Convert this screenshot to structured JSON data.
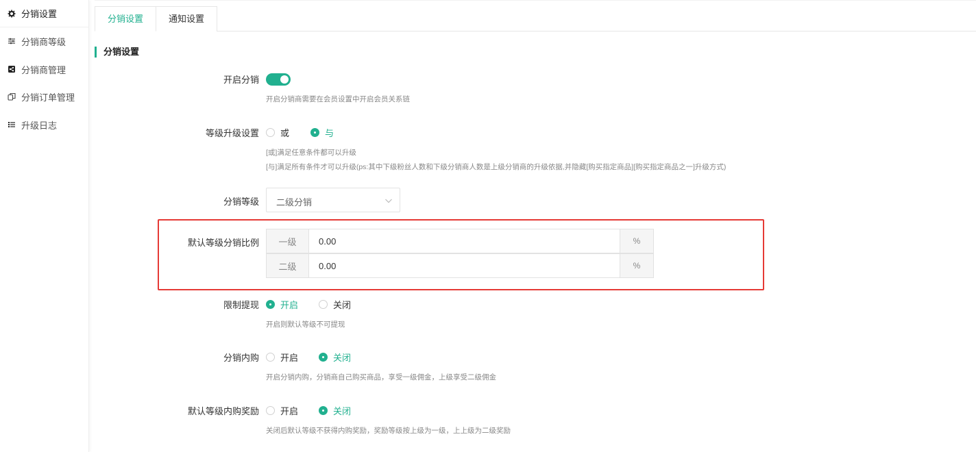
{
  "sidebar": {
    "items": [
      {
        "label": "分销设置",
        "icon": "gear-icon"
      },
      {
        "label": "分销商等级",
        "icon": "sliders-icon"
      },
      {
        "label": "分销商管理",
        "icon": "share-icon"
      },
      {
        "label": "分销订单管理",
        "icon": "copy-icon"
      },
      {
        "label": "升级日志",
        "icon": "list-icon"
      }
    ]
  },
  "tabs": [
    {
      "label": "分销设置"
    },
    {
      "label": "通知设置"
    }
  ],
  "section_title": "分销设置",
  "form": {
    "enable": {
      "label": "开启分销",
      "on": true,
      "hint": "开启分销商需要在会员设置中开启会员关系链"
    },
    "upgrade": {
      "label": "等级升级设置",
      "options": [
        "或",
        "与"
      ],
      "selected": "与",
      "hint1": "[或]满足任意条件都可以升级",
      "hint2": "[与]满足所有条件才可以升级(ps:其中下级粉丝人数和下级分销商人数是上级分销商的升级依据,并隐藏[购买指定商品][购买指定商品之一]升级方式)"
    },
    "level": {
      "label": "分销等级",
      "value": "二级分销"
    },
    "ratio": {
      "label": "默认等级分销比例",
      "rows": [
        {
          "prefix": "一级",
          "value": "0.00",
          "suffix": "%"
        },
        {
          "prefix": "二级",
          "value": "0.00",
          "suffix": "%"
        }
      ]
    },
    "withdraw": {
      "label": "限制提现",
      "options": [
        "开启",
        "关闭"
      ],
      "selected": "开启",
      "hint": "开启则默认等级不可提现"
    },
    "self_buy": {
      "label": "分销内购",
      "options": [
        "开启",
        "关闭"
      ],
      "selected": "关闭",
      "hint": "开启分销内购，分销商自己购买商品，享受一级佣金，上级享受二级佣金"
    },
    "default_reward": {
      "label": "默认等级内购奖励",
      "options": [
        "开启",
        "关闭"
      ],
      "selected": "关闭",
      "hint": "关闭后默认等级不获得内购奖励，奖励等级按上级为一级，上上级为二级奖励"
    }
  },
  "colors": {
    "accent": "#21b08f",
    "highlight": "#e53935"
  }
}
